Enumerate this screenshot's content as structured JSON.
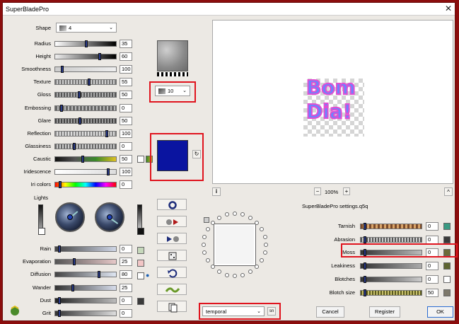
{
  "window": {
    "title": "SuperBladePro"
  },
  "shape": {
    "label": "Shape",
    "value": "4"
  },
  "left_controls": [
    {
      "label": "Radius",
      "value": "35"
    },
    {
      "label": "Height",
      "value": "60"
    },
    {
      "label": "Smoothness",
      "value": "100"
    },
    {
      "label": "Texture",
      "value": "55"
    },
    {
      "label": "Gloss",
      "value": "50"
    },
    {
      "label": "Embossing",
      "value": "0"
    },
    {
      "label": "Glare",
      "value": "50"
    },
    {
      "label": "Reflection",
      "value": "100"
    },
    {
      "label": "Glassiness",
      "value": "0"
    },
    {
      "label": "Caustic",
      "value": "50"
    },
    {
      "label": "Iridescence",
      "value": "100"
    },
    {
      "label": "Iri colors",
      "value": "0"
    }
  ],
  "lights": {
    "label": "Lights"
  },
  "lower_controls": [
    {
      "label": "Rain",
      "value": "0"
    },
    {
      "label": "Evaporation",
      "value": "25"
    },
    {
      "label": "Diffusion",
      "value": "80"
    },
    {
      "label": "Wander",
      "value": "25"
    },
    {
      "label": "Dust",
      "value": "0"
    },
    {
      "label": "Grit",
      "value": "0"
    }
  ],
  "tile_size": {
    "value": "10"
  },
  "color": {
    "swatch": "#0a14a0"
  },
  "preview": {
    "line1": "Bom",
    "line2": "Dia!",
    "zoom": "100%",
    "info": "i",
    "zoom_minus": "−",
    "zoom_plus": "+",
    "up": "^"
  },
  "settings_name": "SuperBladePro settings.q5q",
  "material_controls": [
    {
      "label": "Tarnish",
      "value": "0",
      "chip": "#3a9a82"
    },
    {
      "label": "Abrasion",
      "value": "0",
      "chip": "#3a3a3a"
    },
    {
      "label": "Moss",
      "value": "0",
      "chip": "#6b6b38"
    },
    {
      "label": "Leakiness",
      "value": "0",
      "chip": "#5d6330"
    },
    {
      "label": "Blotches",
      "value": "0",
      "chip": "#ffffff"
    },
    {
      "label": "Blotch size",
      "value": "50",
      "chip": "#7d786a"
    }
  ],
  "mode": {
    "value": "temporal",
    "aux": "sn"
  },
  "buttons": {
    "cancel": "Cancel",
    "register": "Register",
    "ok": "OK"
  }
}
